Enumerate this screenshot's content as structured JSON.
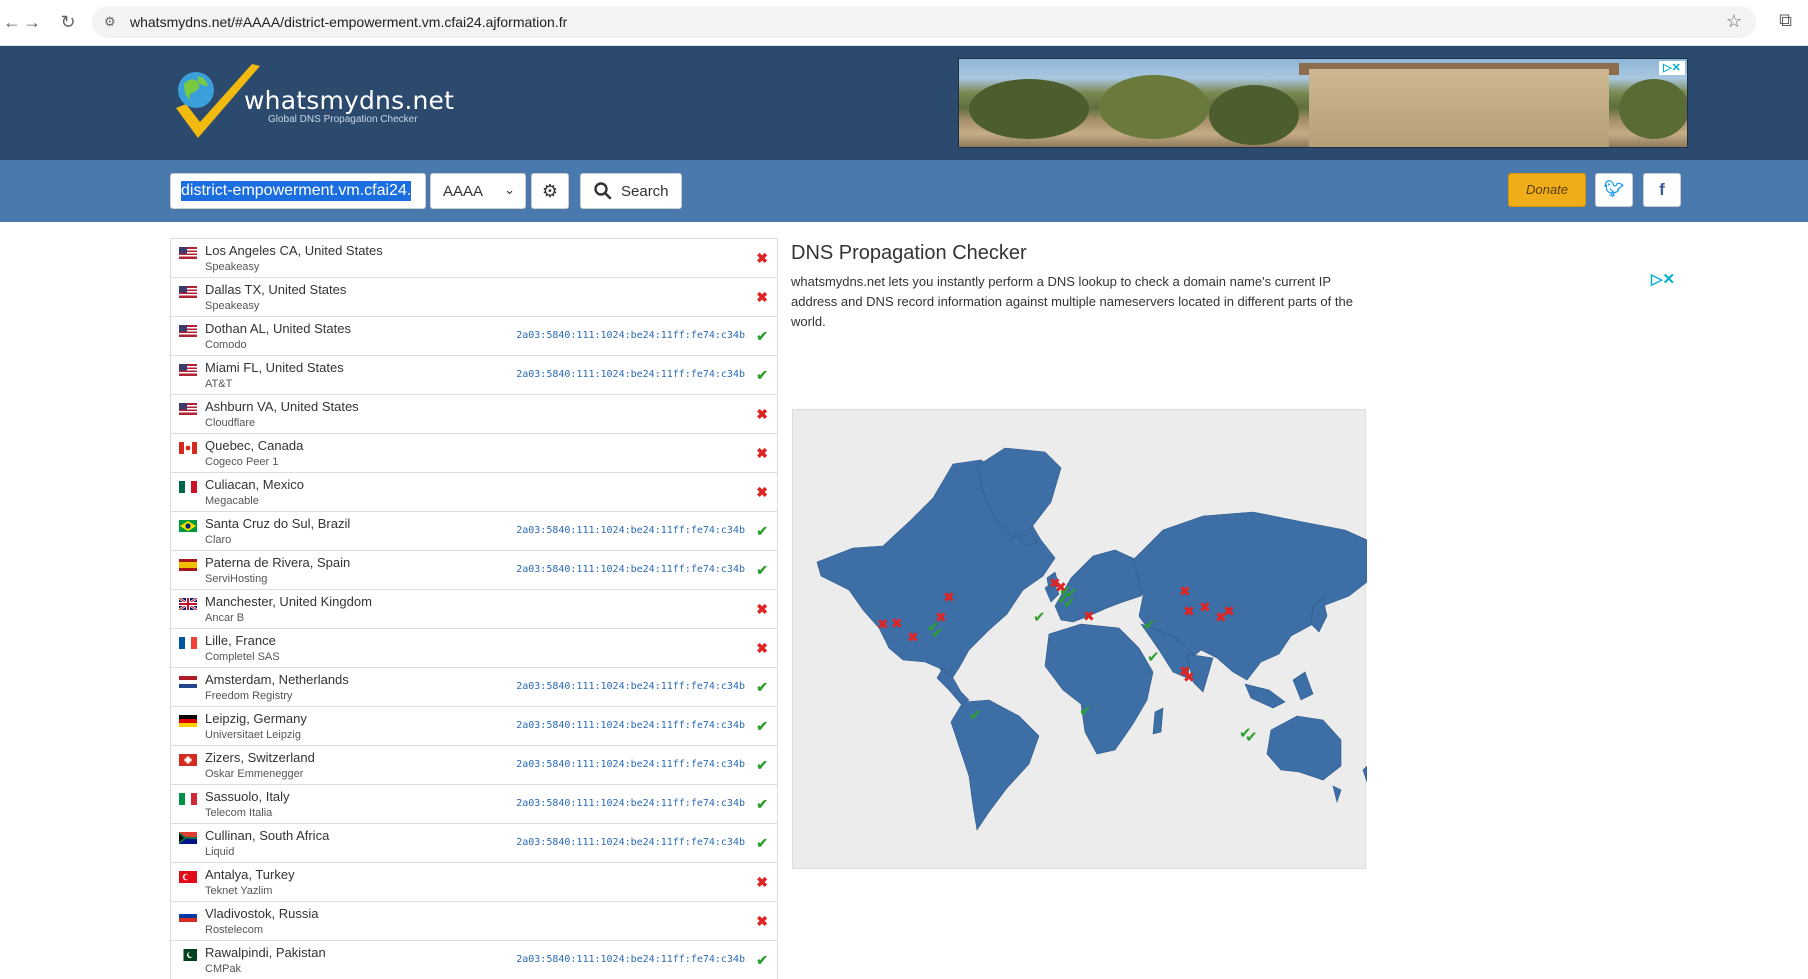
{
  "browser": {
    "url": "whatsmydns.net/#AAAA/district-empowerment.vm.cfai24.ajformation.fr"
  },
  "header": {
    "brand": "whatsmydns.net",
    "tagline": "Global DNS Propagation Checker"
  },
  "search": {
    "domain_value": "district-empowerment.vm.cfai24.",
    "record_type": "AAAA",
    "search_label": "Search",
    "donate_label": "Donate"
  },
  "colors": {
    "header_bg": "#2c4a6e",
    "searchbar_bg": "#4a7aad",
    "ok": "#2da02d",
    "fail": "#e02424",
    "ip_text": "#2a6ab6",
    "donate": "#f0ad1a"
  },
  "results": [
    {
      "location": "Los Angeles CA, United States",
      "provider": "Speakeasy",
      "ip": "",
      "status": "fail",
      "flag": "us"
    },
    {
      "location": "Dallas TX, United States",
      "provider": "Speakeasy",
      "ip": "",
      "status": "fail",
      "flag": "us"
    },
    {
      "location": "Dothan AL, United States",
      "provider": "Comodo",
      "ip": "2a03:5840:111:1024:be24:11ff:fe74:c34b",
      "status": "ok",
      "flag": "us"
    },
    {
      "location": "Miami FL, United States",
      "provider": "AT&T",
      "ip": "2a03:5840:111:1024:be24:11ff:fe74:c34b",
      "status": "ok",
      "flag": "us"
    },
    {
      "location": "Ashburn VA, United States",
      "provider": "Cloudflare",
      "ip": "",
      "status": "fail",
      "flag": "us"
    },
    {
      "location": "Quebec, Canada",
      "provider": "Cogeco Peer 1",
      "ip": "",
      "status": "fail",
      "flag": "ca"
    },
    {
      "location": "Culiacan, Mexico",
      "provider": "Megacable",
      "ip": "",
      "status": "fail",
      "flag": "mx"
    },
    {
      "location": "Santa Cruz do Sul, Brazil",
      "provider": "Claro",
      "ip": "2a03:5840:111:1024:be24:11ff:fe74:c34b",
      "status": "ok",
      "flag": "br"
    },
    {
      "location": "Paterna de Rivera, Spain",
      "provider": "ServiHosting",
      "ip": "2a03:5840:111:1024:be24:11ff:fe74:c34b",
      "status": "ok",
      "flag": "es"
    },
    {
      "location": "Manchester, United Kingdom",
      "provider": "Ancar B",
      "ip": "",
      "status": "fail",
      "flag": "gb"
    },
    {
      "location": "Lille, France",
      "provider": "Completel SAS",
      "ip": "",
      "status": "fail",
      "flag": "fr"
    },
    {
      "location": "Amsterdam, Netherlands",
      "provider": "Freedom Registry",
      "ip": "2a03:5840:111:1024:be24:11ff:fe74:c34b",
      "status": "ok",
      "flag": "nl"
    },
    {
      "location": "Leipzig, Germany",
      "provider": "Universitaet Leipzig",
      "ip": "2a03:5840:111:1024:be24:11ff:fe74:c34b",
      "status": "ok",
      "flag": "de"
    },
    {
      "location": "Zizers, Switzerland",
      "provider": "Oskar Emmenegger",
      "ip": "2a03:5840:111:1024:be24:11ff:fe74:c34b",
      "status": "ok",
      "flag": "ch"
    },
    {
      "location": "Sassuolo, Italy",
      "provider": "Telecom Italia",
      "ip": "2a03:5840:111:1024:be24:11ff:fe74:c34b",
      "status": "ok",
      "flag": "it"
    },
    {
      "location": "Cullinan, South Africa",
      "provider": "Liquid",
      "ip": "2a03:5840:111:1024:be24:11ff:fe74:c34b",
      "status": "ok",
      "flag": "za"
    },
    {
      "location": "Antalya, Turkey",
      "provider": "Teknet Yazlim",
      "ip": "",
      "status": "fail",
      "flag": "tr"
    },
    {
      "location": "Vladivostok, Russia",
      "provider": "Rostelecom",
      "ip": "",
      "status": "fail",
      "flag": "ru"
    },
    {
      "location": "Rawalpindi, Pakistan",
      "provider": "CMPak",
      "ip": "2a03:5840:111:1024:be24:11ff:fe74:c34b",
      "status": "ok",
      "flag": "pk"
    }
  ],
  "info": {
    "title": "DNS Propagation Checker",
    "text": "whatsmydns.net lets you instantly perform a DNS lookup to check a domain name's current IP address and DNS record information against multiple nameservers located in different parts of the world."
  }
}
